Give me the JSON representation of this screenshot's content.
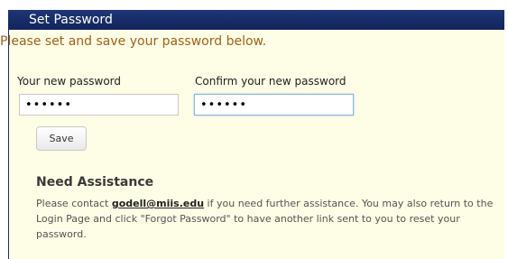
{
  "header": {
    "title": "Set Password"
  },
  "form": {
    "instructions": "Please set and save your password below.",
    "new_password_label": "Your new password",
    "new_password_value": "••••••",
    "confirm_password_label": "Confirm your new password",
    "confirm_password_value": "••••••",
    "save_label": "Save"
  },
  "assistance": {
    "title": "Need Assistance",
    "text_before_link": "Please contact ",
    "email_link": "godell@miis.edu",
    "text_after_link": " if you need further assistance. You may also return to the Login Page and click \"Forgot Password\" to have another link sent to you to reset your password."
  },
  "colors": {
    "titlebar": "#1e3676",
    "panel_background": "#fefde6",
    "instructions_text": "#a0621a"
  }
}
